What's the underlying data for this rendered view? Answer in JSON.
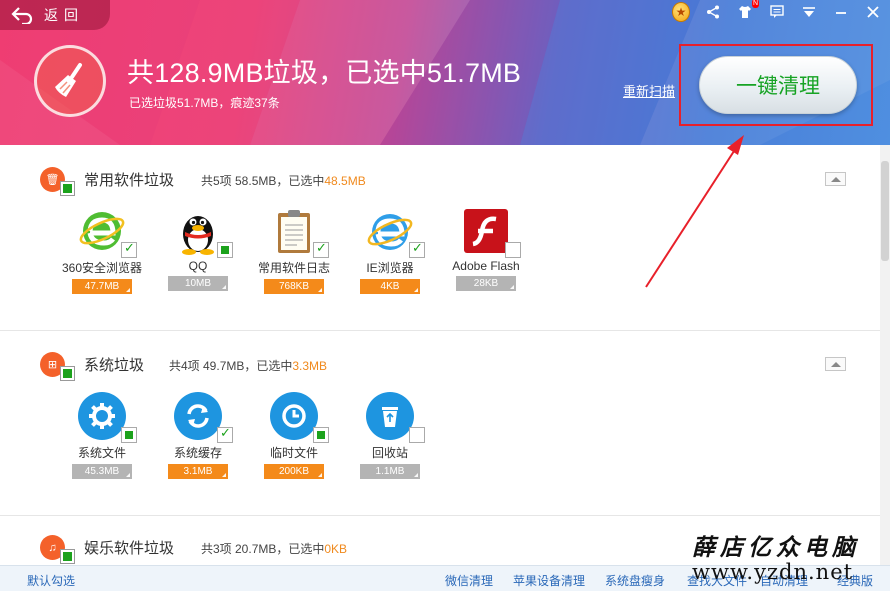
{
  "header": {
    "back_label": "返回",
    "summary_title": "共128.9MB垃圾，已选中51.7MB",
    "summary_sub": "已选垃圾51.7MB，痕迹37条",
    "rescan": "重新扫描",
    "clean_button": "一键清理",
    "new_badge": "N"
  },
  "sections": [
    {
      "title": "常用软件垃圾",
      "meta_prefix": "共5项 58.5MB，已选中",
      "meta_selected": "48.5MB",
      "items": [
        {
          "name": "360安全浏览器",
          "size": "47.7MB",
          "icon": "360-browser-icon",
          "state": "checked"
        },
        {
          "name": "QQ",
          "size": "10MB",
          "icon": "qq-penguin-icon",
          "state": "partial"
        },
        {
          "name": "常用软件日志",
          "size": "768KB",
          "icon": "clipboard-log-icon",
          "state": "checked"
        },
        {
          "name": "IE浏览器",
          "size": "4KB",
          "icon": "ie-browser-icon",
          "state": "checked"
        },
        {
          "name": "Adobe Flash",
          "size": "28KB",
          "icon": "adobe-flash-icon",
          "state": "unchecked"
        }
      ]
    },
    {
      "title": "系统垃圾",
      "meta_prefix": "共4项 49.7MB，已选中",
      "meta_selected": "3.3MB",
      "items": [
        {
          "name": "系统文件",
          "size": "45.3MB",
          "icon": "gear-icon",
          "state": "partial"
        },
        {
          "name": "系统缓存",
          "size": "3.1MB",
          "icon": "refresh-icon",
          "state": "checked"
        },
        {
          "name": "临时文件",
          "size": "200KB",
          "icon": "clock-icon",
          "state": "partial"
        },
        {
          "name": "回收站",
          "size": "1.1MB",
          "icon": "recycle-bin-icon",
          "state": "unchecked"
        }
      ]
    },
    {
      "title": "娱乐软件垃圾",
      "meta_prefix": "共3项 20.7MB，已选中",
      "meta_selected": "0KB"
    }
  ],
  "footer": {
    "default_select": "默认勾选",
    "links": [
      "微信清理",
      "苹果设备清理",
      "系统盘瘦身",
      "查找大文件",
      "自动清理",
      "经典版"
    ]
  },
  "watermark": {
    "cn": "薛店亿众电脑",
    "url": "www.yzdn.net"
  },
  "colors": {
    "accent_orange": "#f48a1a",
    "check_green": "#1ca21c",
    "clean_text_green": "#17a324",
    "highlight_red": "#e8202a",
    "link_blue": "#2a68b8"
  }
}
